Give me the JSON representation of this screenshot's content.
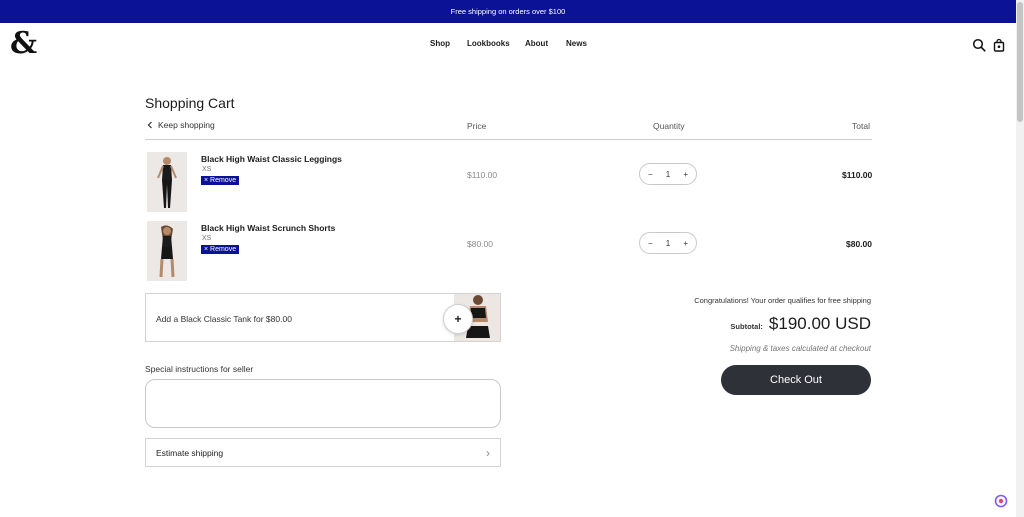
{
  "announcement": "Free shipping on orders over $100",
  "logo": "&",
  "nav": [
    "Shop",
    "Lookbooks",
    "About",
    "News"
  ],
  "header_icons": [
    "search-icon",
    "bag-icon"
  ],
  "cart": {
    "title": "Shopping Cart",
    "keep_shopping": "Keep shopping",
    "columns": {
      "price": "Price",
      "quantity": "Quantity",
      "total": "Total"
    },
    "items": [
      {
        "name": "Black High Waist Classic Leggings",
        "size": "XS",
        "remove": "× Remove",
        "price": "$110.00",
        "qty": "1",
        "total": "$110.00"
      },
      {
        "name": "Black High Waist Scrunch Shorts",
        "size": "XS",
        "remove": "× Remove",
        "price": "$80.00",
        "qty": "1",
        "total": "$80.00"
      }
    ],
    "qty_minus": "−",
    "qty_plus": "+"
  },
  "upsell": {
    "text": "Add a Black Classic Tank for $80.00",
    "add": "+"
  },
  "instructions": {
    "label": "Special instructions for seller",
    "value": ""
  },
  "estimate": {
    "label": "Estimate shipping",
    "chevron": "›"
  },
  "summary": {
    "congrats": "Congratulations! Your order qualifies for free shipping",
    "subtotal_label": "Subtotal:",
    "subtotal_value": "$190.00 USD",
    "shipping_note": "Shipping & taxes calculated at checkout",
    "checkout": "Check Out"
  },
  "colors": {
    "accent": "#0b1296",
    "checkout_bg": "#2e3138"
  }
}
